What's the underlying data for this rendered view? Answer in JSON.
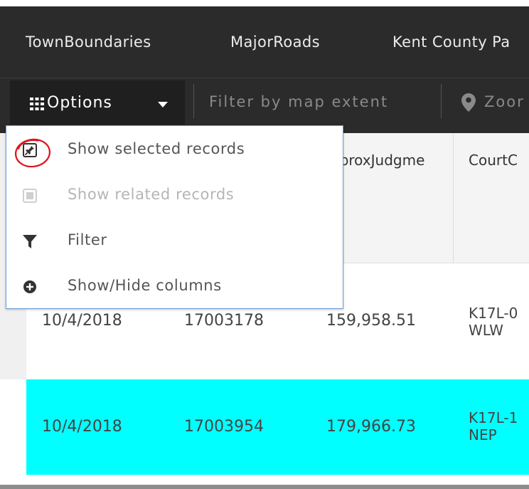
{
  "tabs": [
    "TownBoundaries",
    "MajorRoads",
    "Kent County Pa"
  ],
  "toolbar": {
    "options_label": "Options",
    "filter_extent_label": "Filter by map extent",
    "zoom_label": "Zoor"
  },
  "table": {
    "headers": [
      "pproxJudgme",
      "CourtC"
    ],
    "rows": [
      {
        "date": "10/4/2018",
        "id": "17003178",
        "amount": "159,958.51",
        "court_line1": "K17L-0",
        "court_line2": "WLW",
        "highlighted": false
      },
      {
        "date": "10/4/2018",
        "id": "17003954",
        "amount": "179,966.73",
        "court_line1": "K17L-1",
        "court_line2": "NEP",
        "highlighted": true
      }
    ],
    "highlight_color": "#00ffff"
  },
  "menu": {
    "items": [
      {
        "label": "Show selected records",
        "icon": "pin-icon",
        "enabled": true
      },
      {
        "label": "Show related records",
        "icon": "square-icon",
        "enabled": false
      },
      {
        "label": "Filter",
        "icon": "filter-icon",
        "enabled": true
      },
      {
        "label": "Show/Hide columns",
        "icon": "plus-circle-icon",
        "enabled": true
      }
    ],
    "annotation_color": "#e0141e"
  }
}
